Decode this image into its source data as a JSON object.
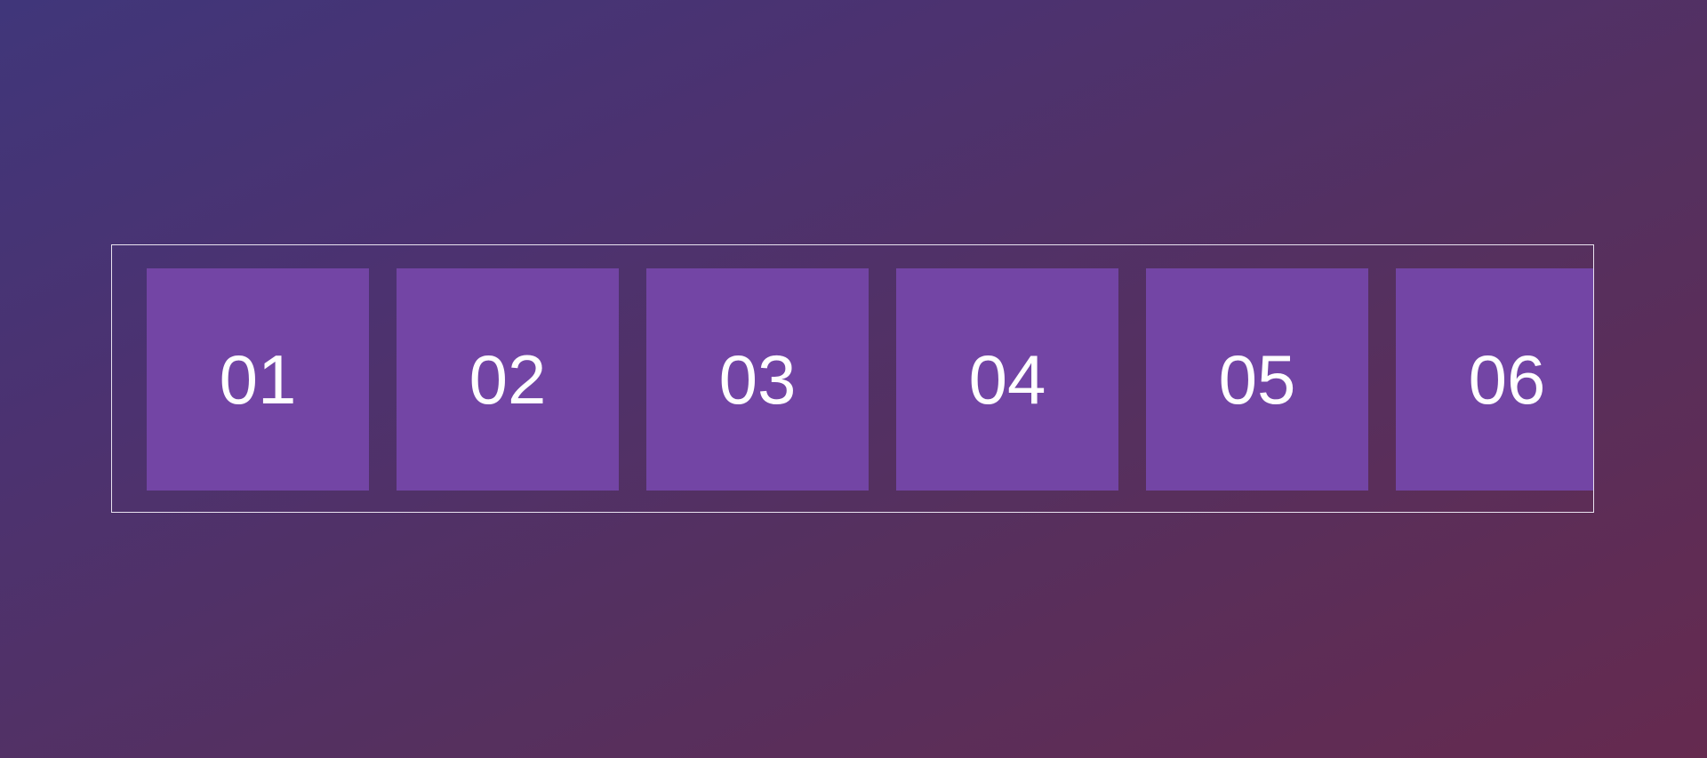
{
  "carousel": {
    "slides": [
      {
        "label": "01"
      },
      {
        "label": "02"
      },
      {
        "label": "03"
      },
      {
        "label": "04"
      },
      {
        "label": "05"
      },
      {
        "label": "06"
      }
    ]
  },
  "colors": {
    "slide_background": "#7345a5",
    "slide_text": "#ffffff",
    "frame_border": "#e9e3f0",
    "background_start": "#40367a",
    "background_end": "#652a4f"
  }
}
